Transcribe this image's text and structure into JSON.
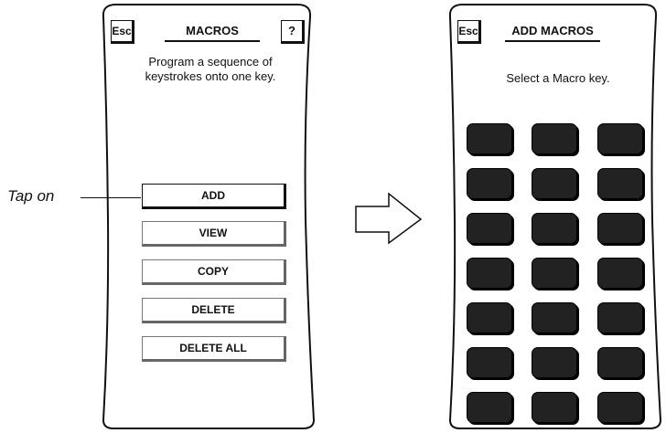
{
  "annotation": {
    "tap_label": "Tap on"
  },
  "left_screen": {
    "esc_label": "Esc",
    "title": "MACROS",
    "help_label": "?",
    "description_lines": [
      "Program a sequence of",
      "keystrokes onto one key."
    ],
    "buttons": [
      "ADD",
      "VIEW",
      "COPY",
      "DELETE",
      "DELETE ALL"
    ]
  },
  "right_screen": {
    "esc_label": "Esc",
    "title": "ADD MACROS",
    "instruction": "Select a Macro key.",
    "macro_key_rows": 7,
    "macro_key_columns": 3
  },
  "colors": {
    "ink": "#111111",
    "key_fill": "#222222",
    "background": "#ffffff"
  }
}
